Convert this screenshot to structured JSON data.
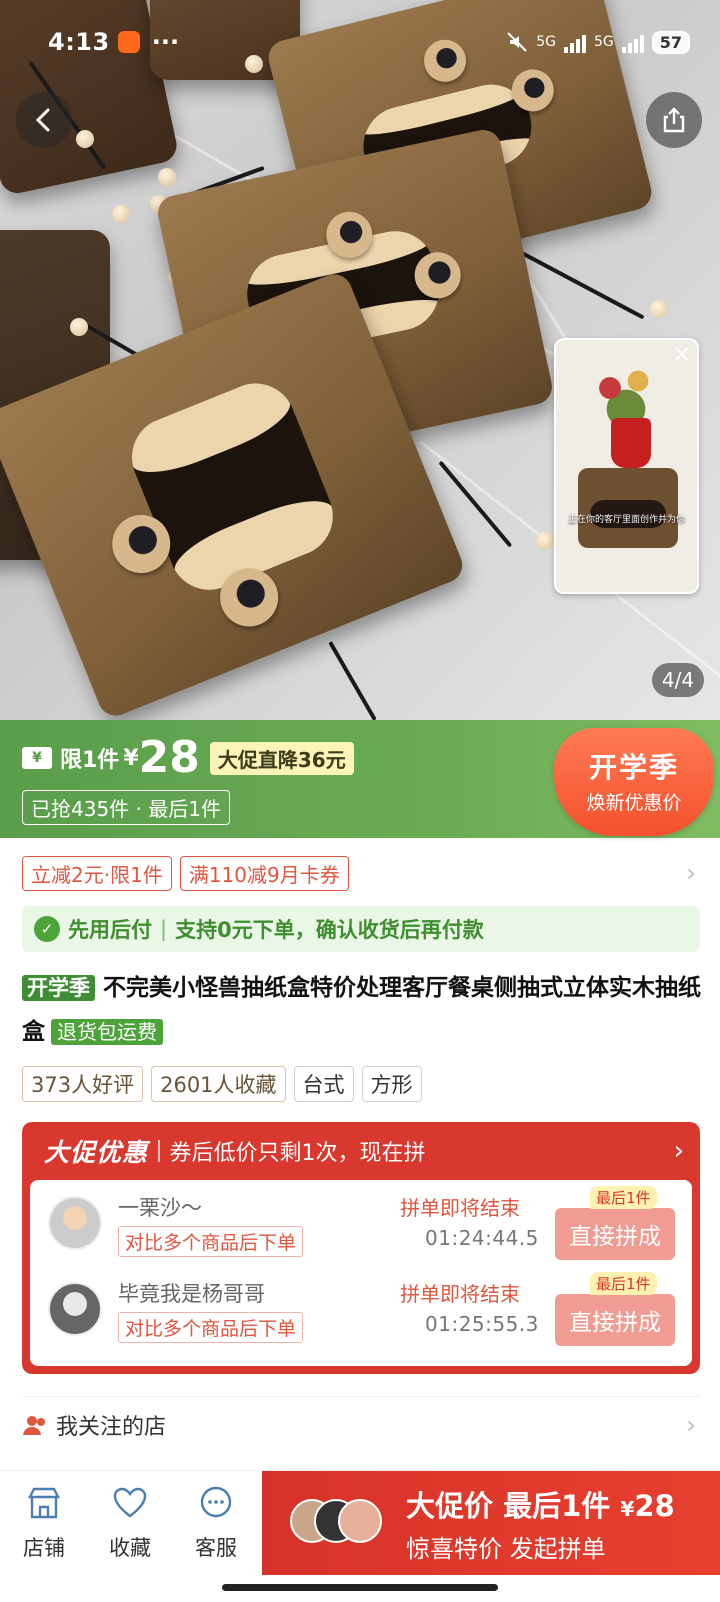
{
  "status_bar": {
    "time": "4:13",
    "more": "···",
    "net1": "5G",
    "net2": "5G",
    "battery": "57"
  },
  "gallery": {
    "pager": "4/4",
    "thumb_caption": "正在你的客厅里面创作并为你"
  },
  "price_banner": {
    "ticket_icon": "¥",
    "limit_label": "限1件",
    "currency": "¥",
    "price": "28",
    "promo_tag": "大促直降36元",
    "sold_info": "已抢435件 · 最后1件",
    "season_title": "开学季",
    "season_sub": "焕新优惠价"
  },
  "coupons": [
    "立减2元·限1件",
    "满110减9月卡券"
  ],
  "pay_later": {
    "label": "先用后付",
    "desc": "支持0元下单，确认收货后再付款"
  },
  "product": {
    "season_tag": "开学季",
    "title": "不完美小怪兽抽纸盒特价处理客厅餐桌侧抽式立体实木抽纸盒",
    "return_tag": "退货包运费"
  },
  "attributes": [
    "373人好评",
    "2601人收藏",
    "台式",
    "方形"
  ],
  "group_buy": {
    "header_big": "大促优惠",
    "header_text": "券后低价只剩1次，现在拼",
    "buyers": [
      {
        "name": "一栗沙～",
        "hint": "对比多个商品后下单",
        "ending": "拼单即将结束",
        "timer": "01:24:44.5",
        "button": "直接拼成",
        "badge": "最后1件"
      },
      {
        "name": "毕竟我是杨哥哥",
        "hint": "对比多个商品后下单",
        "ending": "拼单即将结束",
        "timer": "01:25:55.3",
        "button": "直接拼成",
        "badge": "最后1件"
      }
    ]
  },
  "follow": {
    "label": "我关注的店"
  },
  "bottom_bar": {
    "nav": [
      {
        "label": "店铺",
        "icon": "store-icon"
      },
      {
        "label": "收藏",
        "icon": "heart-icon"
      },
      {
        "label": "客服",
        "icon": "chat-icon"
      }
    ],
    "cta_line1": "大促价 最后1件",
    "cta_currency": "¥",
    "cta_price": "28",
    "cta_line2": "惊喜特价 发起拼单"
  },
  "colors": {
    "brand_green": "#5a9e4a",
    "promo_red": "#d9382e",
    "accent_orange": "#f4502d"
  }
}
